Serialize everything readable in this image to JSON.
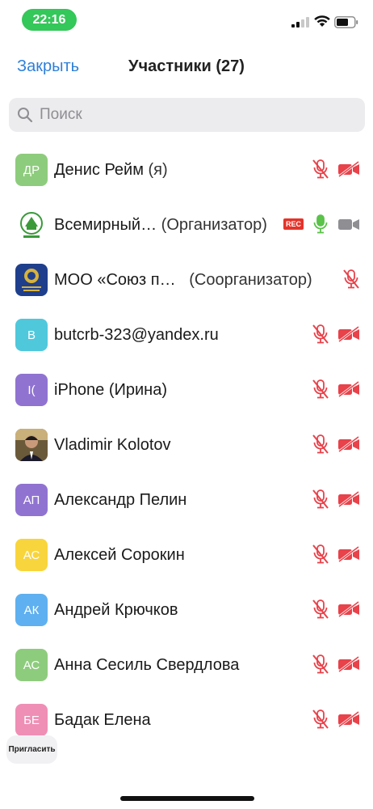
{
  "status_bar": {
    "time": "22:16"
  },
  "nav": {
    "close_label": "Закрыть",
    "title": "Участники (27)"
  },
  "search": {
    "placeholder": "Поиск"
  },
  "participants": [
    {
      "initials": "ДР",
      "avatar_color": "#8ecc7d",
      "name": "Денис Рейм",
      "role": "(я)",
      "mic": "muted",
      "video": "off"
    },
    {
      "initials": "",
      "avatar_type": "logo-green",
      "name": "Всемирный…",
      "role": "(Организатор)",
      "rec": "REC",
      "mic": "on",
      "video": "off-gray"
    },
    {
      "initials": "",
      "avatar_type": "logo-blue",
      "name": "МОО «Союз п…",
      "role": "(Соорганизатор)",
      "mic": "muted",
      "video": "none"
    },
    {
      "initials": "B",
      "avatar_color": "#4fc8dc",
      "name": "butcrb-323@yandex.ru",
      "role": "",
      "mic": "muted",
      "video": "off"
    },
    {
      "initials": "I(",
      "avatar_color": "#9073d1",
      "name": "iPhone (Ирина)",
      "role": "",
      "mic": "muted",
      "video": "off"
    },
    {
      "initials": "",
      "avatar_type": "photo",
      "name": "Vladimir Kolotov",
      "role": "",
      "mic": "muted",
      "video": "off"
    },
    {
      "initials": "АП",
      "avatar_color": "#9073d1",
      "name": "Александр Пелин",
      "role": "",
      "mic": "muted",
      "video": "off"
    },
    {
      "initials": "АС",
      "avatar_color": "#f8d53c",
      "name": "Алексей Сорокин",
      "role": "",
      "mic": "muted",
      "video": "off"
    },
    {
      "initials": "АК",
      "avatar_color": "#5fb0f0",
      "name": "Андрей Крючков",
      "role": "",
      "mic": "muted",
      "video": "off"
    },
    {
      "initials": "АС",
      "avatar_color": "#8ecc7d",
      "name": "Анна Сесиль Свердлова",
      "role": "",
      "mic": "muted",
      "video": "off"
    },
    {
      "initials": "БЕ",
      "avatar_color": "#ef8fb5",
      "name": "Бадак Елена",
      "role": "",
      "mic": "muted",
      "video": "off"
    }
  ],
  "invite": {
    "label": "Пригласить"
  },
  "colors": {
    "accent": "#2f7fd8",
    "muted_red": "#e8424a",
    "mic_on_green": "#5bc24a",
    "rec_red": "#e5332a"
  }
}
